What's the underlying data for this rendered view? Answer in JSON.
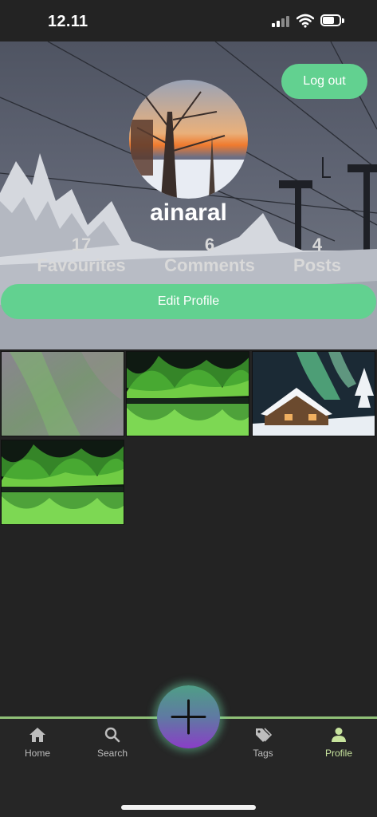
{
  "status_bar": {
    "time": "12.11"
  },
  "header": {
    "logout_label": "Log out",
    "username": "ainaral",
    "stats": [
      {
        "value": "17",
        "label": "Favourites"
      },
      {
        "value": "6",
        "label": "Comments"
      },
      {
        "value": "4",
        "label": "Posts"
      }
    ],
    "edit_profile_label": "Edit Profile"
  },
  "posts": [
    {
      "name": "aurora-pink-sky"
    },
    {
      "name": "aurora-lake-reflection"
    },
    {
      "name": "aurora-snowy-cabin"
    },
    {
      "name": "aurora-lake-reflection-2"
    }
  ],
  "bottom_nav": {
    "items": [
      {
        "label": "Home",
        "icon": "home-icon"
      },
      {
        "label": "Search",
        "icon": "search-icon"
      },
      {
        "label": "Tags",
        "icon": "tags-icon"
      },
      {
        "label": "Profile",
        "icon": "person-icon",
        "active": true
      }
    ],
    "fab_icon": "plus-icon"
  },
  "colors": {
    "accent": "#62d190",
    "nav_active": "#c7e39d",
    "background": "#232323"
  }
}
